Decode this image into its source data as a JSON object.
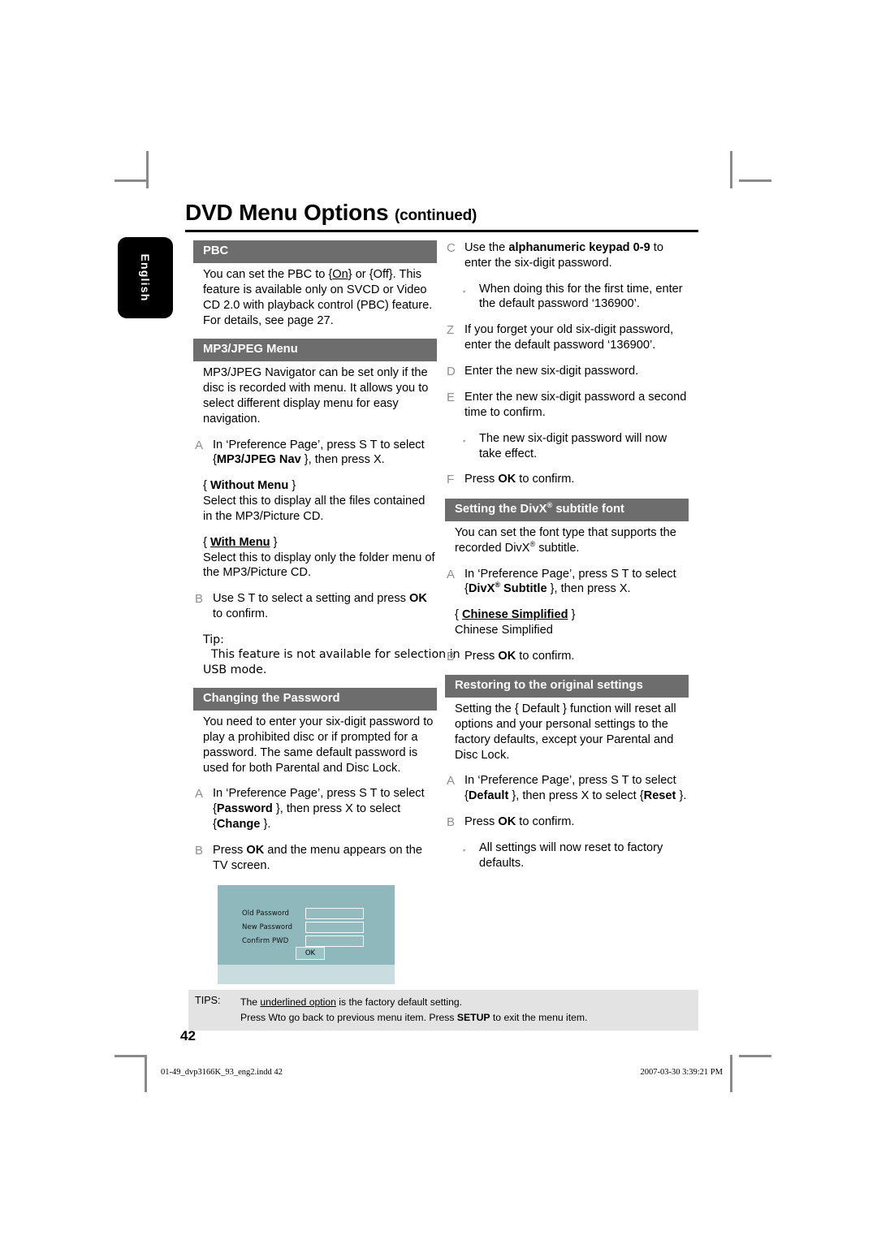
{
  "header": {
    "title": "DVD Menu Options",
    "title_suffix": "(continued)",
    "language_tab": "English"
  },
  "left_column": {
    "pbc": {
      "heading": "PBC",
      "intro_1": "You can set the PBC to {",
      "intro_on": "On",
      "intro_2": "} or {Off}. This feature is available only on SVCD or Video CD 2.0 with playback control (PBC) feature. For details, see page 27."
    },
    "mp3jpeg": {
      "heading": "MP3/JPEG Menu",
      "intro": "MP3/JPEG Navigator can be set only if the disc is recorded with menu. It allows you to select different display menu for easy navigation.",
      "steps": [
        {
          "letter": "A",
          "t1": "In ‘Preference Page’, press  S  T to select {",
          "bold": "MP3/JPEG Nav",
          "t2": " }, then press  X."
        }
      ],
      "option_without": {
        "open": "{",
        "label": "Without Menu",
        "close": "}",
        "desc": "Select this to display all the files contained in the MP3/Picture CD."
      },
      "option_with": {
        "open": "{",
        "label": "With Menu",
        "close": "}",
        "desc": "Select this to display only the folder menu of the MP3/Picture CD."
      },
      "step_b": {
        "letter": "B",
        "t1": "Use  S  T to select a setting and press ",
        "bold": "OK",
        "t2": " to confirm."
      },
      "tip_label": "Tip:",
      "tip_body": "This feature is not available for selection in",
      "tip_body2": "USB mode."
    },
    "password": {
      "heading": "Changing the Password",
      "intro": "You need to enter your six-digit password to play a prohibited disc or if prompted for a password. The same default password is used for both Parental and Disc Lock.",
      "step_a": {
        "letter": "A",
        "t1": "In ‘Preference Page’, press  S  T to select {",
        "bold1": "Password",
        "t2": " }, then press  X to select {",
        "bold2": "Change",
        "t3": " }."
      },
      "step_b": {
        "letter": "B",
        "t1": "Press ",
        "bold": "OK",
        "t2": " and the menu appears on the TV screen."
      }
    },
    "screenshot": {
      "rows": [
        "Old  Password",
        "New Password",
        "Confirm PWD"
      ],
      "ok_label": "OK"
    }
  },
  "right_column": {
    "password_steps": {
      "step_c": {
        "letter": "C",
        "t1": "Use the ",
        "bold": "alphanumeric keypad 0-9",
        "t2": " to enter the six-digit password."
      },
      "bullet_c": "When doing this for the first time, enter the default password ‘136900’.",
      "step_z": {
        "letter": "Z",
        "t1": "If you forget your old six-digit password, enter the default password ‘136900’."
      },
      "step_d": {
        "letter": "D",
        "t1": "Enter the new six-digit password."
      },
      "step_e": {
        "letter": "E",
        "t1": "Enter the new six-digit password a second time to confirm."
      },
      "bullet_e": "The new six-digit password will now take effect.",
      "step_f": {
        "letter": "F",
        "t1": "Press ",
        "bold": "OK",
        "t2": " to confirm."
      }
    },
    "divx": {
      "heading_1": "Setting the DivX",
      "heading_sup": "®",
      "heading_2": " subtitle font",
      "intro_1": "You can set the font type that supports the recorded DivX",
      "intro_sup": "®",
      "intro_2": " subtitle.",
      "step_a": {
        "letter": "A",
        "t1": "In ‘Preference Page’, press  S  T to select {",
        "bold1": "DivX",
        "sup": "®",
        "bold2": " Subtitle",
        "t2": " }, then press  X."
      },
      "option": {
        "open": "{",
        "label": "Chinese Simplified",
        "close": "}",
        "desc": "Chinese Simplified"
      },
      "step_b": {
        "letter": "B",
        "t1": "Press ",
        "bold": "OK",
        "t2": " to confirm."
      }
    },
    "restore": {
      "heading": "Restoring to the original settings",
      "intro": "Setting the { Default } function will reset all options and your personal settings to the factory defaults, except your Parental and Disc Lock.",
      "step_a": {
        "letter": "A",
        "t1": "In ‘Preference Page’, press  S  T to select {",
        "bold1": "Default",
        "t2": " }, then press  X to select {",
        "bold2": "Reset",
        "t3": " }."
      },
      "step_b": {
        "letter": "B",
        "t1": "Press ",
        "bold": "OK",
        "t2": " to confirm."
      },
      "bullet_b": "All settings will now reset to factory defaults."
    }
  },
  "tips": {
    "label": "TIPS:",
    "line1_a": "The ",
    "line1_u": "underlined option",
    "line1_b": " is the factory default setting.",
    "line2_a": "Press   Wto go back to previous menu item. Press ",
    "line2_bold": "SETUP",
    "line2_b": " to exit the menu item."
  },
  "page_number": "42",
  "printer_footer": {
    "file": "01-49_dvp3166K_93_eng2.indd   42",
    "timestamp": "2007-03-30   3:39:21 PM"
  }
}
